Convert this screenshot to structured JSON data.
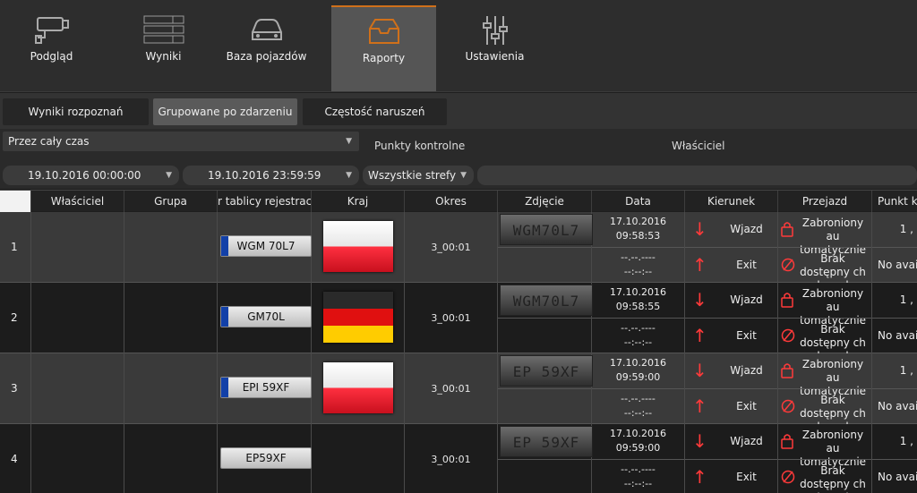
{
  "nav": [
    {
      "label": "Podgląd",
      "icon": "camera-icon"
    },
    {
      "label": "Wyniki",
      "icon": "results-list-icon"
    },
    {
      "label": "Baza pojazdów",
      "icon": "car-icon"
    },
    {
      "label": "Raporty",
      "icon": "inbox-tray-icon",
      "active": true
    },
    {
      "label": "Ustawienia",
      "icon": "sliders-icon"
    }
  ],
  "subtabs": [
    "Wyniki rozpoznań",
    "Grupowane po zdarzeniu",
    "Częstość naruszeń"
  ],
  "active_subtab": 1,
  "filters": {
    "period": "Przez cały czas",
    "checkpoints_label": "Punkty kontrolne",
    "owner_label": "Właściciel",
    "date_from": "19.10.2016 00:00:00",
    "date_to": "19.10.2016 23:59:59",
    "zones": "Wszystkie strefy",
    "owner_value": ""
  },
  "columns": [
    "",
    "Właściciel",
    "Grupa",
    "r tablicy rejestrac",
    "Kraj",
    "Okres",
    "Zdjęcie",
    "Data",
    "Kierunek",
    "Przejazd",
    "Punkt k"
  ],
  "rows": [
    {
      "num": "1",
      "plate": "WGM    70L7",
      "eu": true,
      "flag": "pl",
      "period": "3_00:01",
      "photo": "WGM70L7",
      "in": {
        "date": "17.10.2016",
        "time": "09:58:53",
        "dir": "Wjazd",
        "pass": "Zabroniony au tomatycznie",
        "point": "1 ,"
      },
      "out": {
        "date": "--.--.----",
        "time": "--:--:--",
        "dir": "Exit",
        "pass": "Brak dostępny ch danych",
        "point": "No avail"
      }
    },
    {
      "num": "2",
      "plate": "GM70L",
      "eu": true,
      "flag": "de",
      "period": "3_00:01",
      "photo": "WGM70L7",
      "in": {
        "date": "17.10.2016",
        "time": "09:58:55",
        "dir": "Wjazd",
        "pass": "Zabroniony au tomatycznie",
        "point": "1 ,"
      },
      "out": {
        "date": "--.--.----",
        "time": "--:--:--",
        "dir": "Exit",
        "pass": "Brak dostępny ch danych",
        "point": "No avail"
      }
    },
    {
      "num": "3",
      "plate": "EPI     59XF",
      "eu": true,
      "flag": "pl",
      "period": "3_00:01",
      "photo": "EP 59XF",
      "in": {
        "date": "17.10.2016",
        "time": "09:59:00",
        "dir": "Wjazd",
        "pass": "Zabroniony au tomatycznie",
        "point": "1 ,"
      },
      "out": {
        "date": "--.--.----",
        "time": "--:--:--",
        "dir": "Exit",
        "pass": "Brak dostępny ch danych",
        "point": "No avail"
      }
    },
    {
      "num": "4",
      "plate": "EP59XF",
      "eu": false,
      "flag": "",
      "period": "3_00:01",
      "photo": "EP 59XF",
      "in": {
        "date": "17.10.2016",
        "time": "09:59:00",
        "dir": "Wjazd",
        "pass": "Zabroniony au tomatycznie",
        "point": "1 ,"
      },
      "out": {
        "date": "--.--.----",
        "time": "--:--:--",
        "dir": "Exit",
        "pass": "Brak dostępny ch danych",
        "point": "No avail"
      }
    }
  ],
  "colors": {
    "accent": "#d0701a",
    "arrow": "#ff3a3a",
    "eu_blue": "#1240a8"
  }
}
